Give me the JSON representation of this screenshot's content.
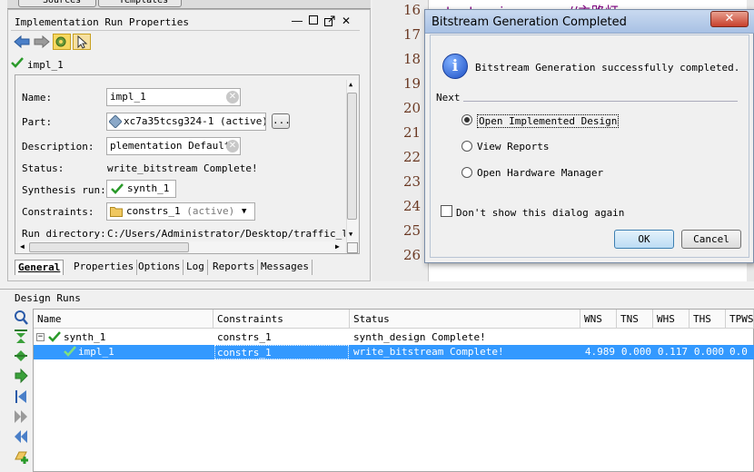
{
  "top_tabs": [
    "Sources",
    "Templates"
  ],
  "props_panel": {
    "title": "Implementation Run Properties",
    "object_name": "impl_1",
    "fields": {
      "name_label": "Name:",
      "name_value": "impl_1",
      "part_label": "Part:",
      "part_value": "xc7a35tcsg324-1 (active)",
      "part_browse": "...",
      "description_label": "Description:",
      "description_value": "plementation Defaults",
      "status_label": "Status:",
      "status_value": "write_bitstream Complete!",
      "synth_label": "Synthesis run:",
      "synth_value": "synth_1",
      "constraints_label": "Constraints:",
      "constraints_value": "constrs_1",
      "constraints_tag": "(active)",
      "rundir_label": "Run directory:",
      "rundir_value": "C:/Users/Administrator/Desktop/traffic_light"
    },
    "tabs": [
      "General",
      "Properties",
      "Options",
      "Log",
      "Reports",
      "Messages"
    ]
  },
  "editor": {
    "line_numbers": [
      "16",
      "17",
      "18",
      "19",
      "20",
      "21",
      "22",
      "23",
      "24",
      "25",
      "26"
    ],
    "code_fragment": "output main_green, //主路灯"
  },
  "dialog": {
    "title": "Bitstream Generation Completed",
    "close_glyph": "✕",
    "message": "Bitstream Generation successfully completed.",
    "next_label": "Next",
    "options": [
      "Open Implemented Design",
      "View Reports",
      "Open Hardware Manager"
    ],
    "selected_option": "Open Implemented Design",
    "dont_show": "Don't show this dialog again",
    "ok": "OK",
    "cancel": "Cancel"
  },
  "design_runs": {
    "title": "Design Runs",
    "columns": [
      "Name",
      "Constraints",
      "Status",
      "WNS",
      "TNS",
      "WHS",
      "THS",
      "TPWS"
    ],
    "rows": [
      {
        "name": "synth_1",
        "constraints": "constrs_1",
        "status": "synth_design Complete!",
        "wns": "",
        "tns": "",
        "whs": "",
        "ths": "",
        "tpws": ""
      },
      {
        "name": "impl_1",
        "constraints": "constrs_1",
        "status": "write_bitstream Complete!",
        "wns": "4.989",
        "tns": "0.000",
        "whs": "0.117",
        "ths": "0.000",
        "tpws": "0.0"
      }
    ]
  },
  "colors": {
    "selection": "#3399ff",
    "check_green": "#2a9a2a",
    "line_number": "#6b3a24",
    "code_keyword": "#800080"
  }
}
